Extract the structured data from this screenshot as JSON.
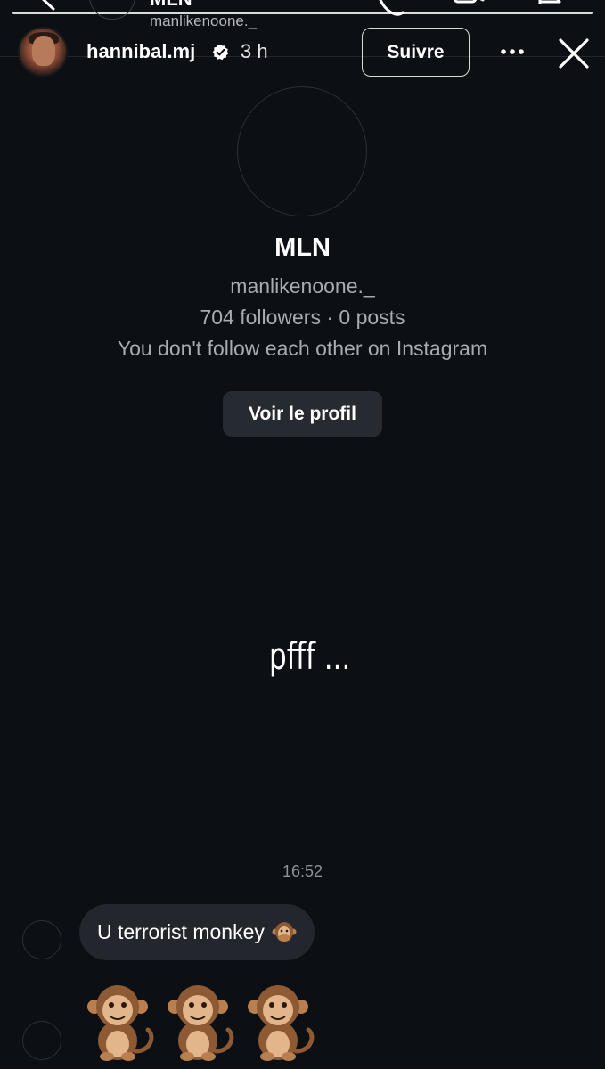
{
  "background_chat": {
    "title": "MLN",
    "subtitle": "manlikenoone._"
  },
  "story": {
    "username": "hannibal.mj",
    "time": "3 h",
    "follow_label": "Suivre",
    "caption": "pfff ..."
  },
  "profile_card": {
    "name": "MLN",
    "handle": "manlikenoone._",
    "stats": "704 followers · 0 posts",
    "note": "You don't follow each other on Instagram",
    "view_profile_label": "Voir le profil"
  },
  "messages": {
    "timestamp": "16:52",
    "text": "U terrorist monkey",
    "inline_emoji": "speak-no-evil-monkey",
    "emoji_row": [
      "monkey",
      "monkey",
      "monkey"
    ]
  },
  "colors": {
    "background": "#0c0f14",
    "bubble": "#23262c",
    "secondary_text": "#a8abb1",
    "verified_badge": "#ffffff"
  }
}
